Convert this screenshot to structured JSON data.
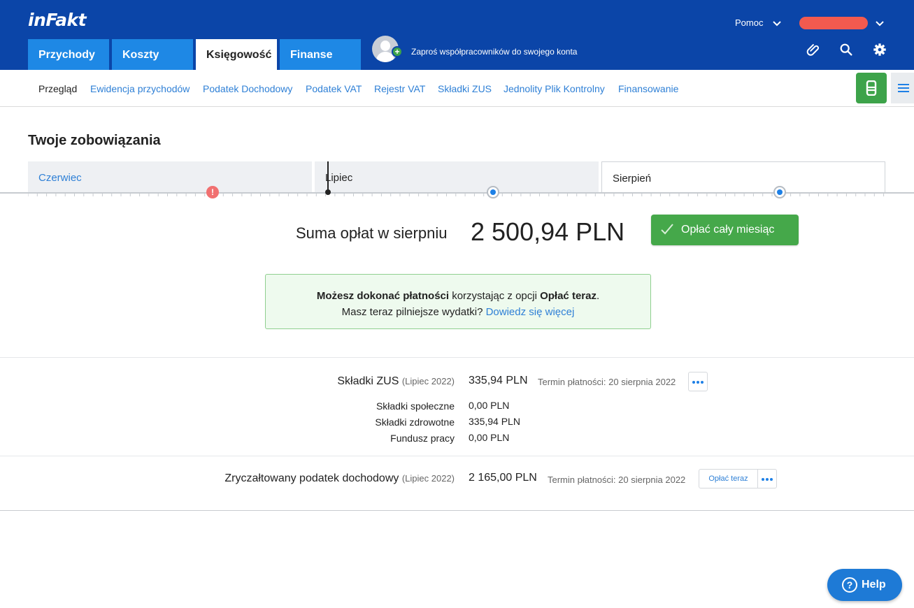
{
  "header": {
    "logo": "inFakt",
    "tabs": [
      "Przychody",
      "Koszty",
      "Księgowość",
      "Finanse"
    ],
    "invite_text": "Zaproś współpracowników do swojego konta",
    "help_label": "Pomoc",
    "icons": [
      "paperclip-icon",
      "search-icon",
      "gear-icon"
    ]
  },
  "subnav": {
    "items": [
      "Przegląd",
      "Ewidencja przychodów",
      "Podatek Dochodowy",
      "Podatek VAT",
      "Rejestr VAT",
      "Składki ZUS",
      "Jednolity Plik Kontrolny",
      "Finansowanie"
    ],
    "active": "Przegląd"
  },
  "page": {
    "title": "Twoje zobowiązania",
    "months": [
      "Czerwiec",
      "Lipiec",
      "Sierpień"
    ],
    "selected_month": "Sierpień"
  },
  "summary": {
    "label": "Suma opłat w sierpniu",
    "value": "2 500,94 PLN",
    "pay_all_label": "Opłać cały miesiąc"
  },
  "notice": {
    "line1_bold1": "Możesz dokonać płatności",
    "line1_mid": " korzystając z opcji ",
    "line1_bold2": "Opłać teraz",
    "line1_end": ".",
    "line2_text": "Masz teraz pilniejsze wydatki? ",
    "line2_link": "Dowiedz się więcej"
  },
  "obligations": [
    {
      "title": "Składki ZUS",
      "period": "(Lipiec 2022)",
      "amount": "335,94 PLN",
      "deadline": "Termin płatności: 20 sierpnia 2022",
      "details": [
        {
          "label": "Składki społeczne",
          "value": "0,00 PLN"
        },
        {
          "label": "Składki zdrowotne",
          "value": "335,94 PLN"
        },
        {
          "label": "Fundusz pracy",
          "value": "0,00 PLN"
        }
      ]
    },
    {
      "title": "Zryczałtowany podatek dochodowy",
      "period": "(Lipiec 2022)",
      "amount": "2 165,00 PLN",
      "deadline": "Termin płatności: 20 sierpnia 2022",
      "pay_now_label": "Opłać teraz"
    }
  ],
  "help_button": "Help",
  "colors": {
    "header_bg": "#0b45a8",
    "tab_blue": "#1e88e5",
    "link_blue": "#2f80d6",
    "green": "#45a84a",
    "alert_red": "#f17070"
  }
}
